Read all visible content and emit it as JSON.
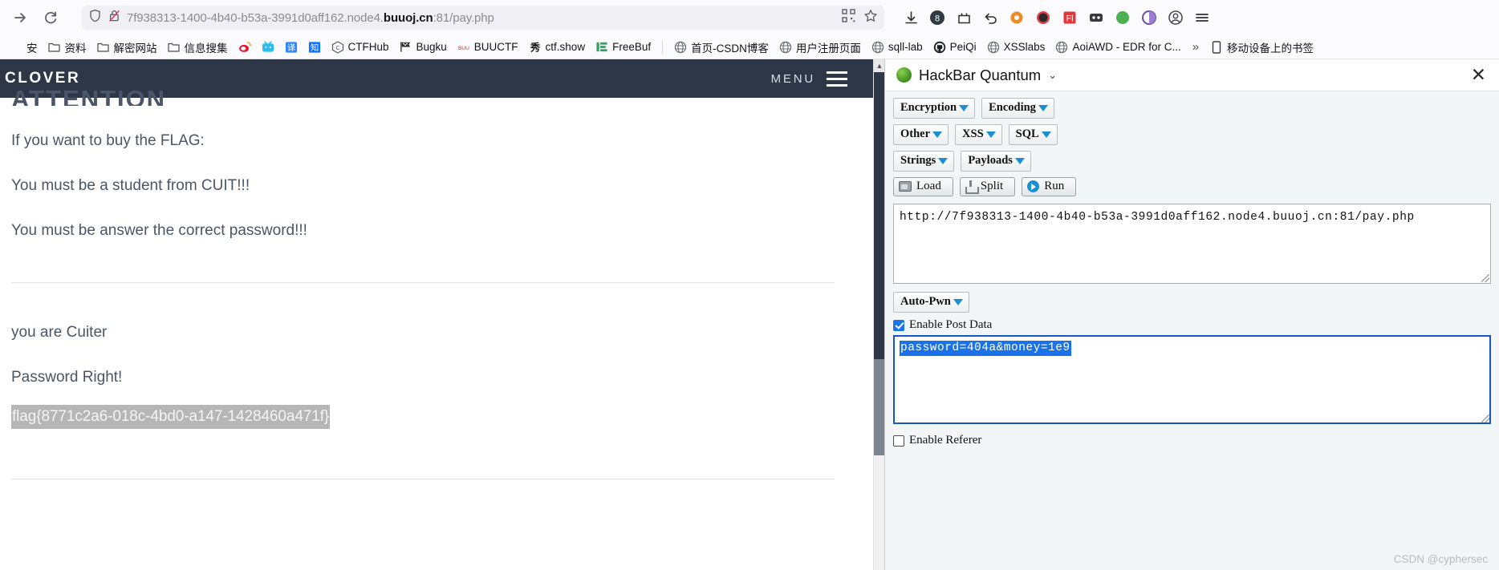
{
  "browser": {
    "nav": {
      "forward_icon": "arrow-right-icon",
      "reload_icon": "reload-icon"
    },
    "url": {
      "prefix": "7f938313-1400-4b40-b53a-3991d0aff162.node4.",
      "host": "buuoj.cn",
      "suffix": ":81/pay.php",
      "full": "7f938313-1400-4b40-b53a-3991d0aff162.node4.buuoj.cn:81/pay.php",
      "shield_icon": "shield-icon",
      "lock_broken_icon": "lock-crossed-icon",
      "qr_icon": "qr-code-icon",
      "bookmark_icon": "star-icon"
    },
    "extensions": [
      {
        "name": "downloads-icon",
        "glyph": "⬇"
      },
      {
        "name": "hackbar-badge-icon",
        "glyph": "8"
      },
      {
        "name": "screenshot-icon",
        "glyph": "⬚"
      },
      {
        "name": "undo-icon",
        "glyph": "↩"
      },
      {
        "name": "orange-gear-icon",
        "glyph": "⚙"
      },
      {
        "name": "block-icon",
        "glyph": "⛔"
      },
      {
        "name": "flash-red-icon",
        "glyph": "F"
      },
      {
        "name": "dark-square-icon",
        "glyph": "▭"
      },
      {
        "name": "green-circle-icon",
        "glyph": "●"
      },
      {
        "name": "palette-icon",
        "glyph": "◐"
      },
      {
        "name": "account-icon",
        "glyph": "○"
      },
      {
        "name": "menu-icon",
        "glyph": "☰"
      }
    ],
    "bookmarks": [
      {
        "label": "安",
        "icon": "text-icon",
        "truncated": true
      },
      {
        "label": "资料",
        "icon": "folder-icon"
      },
      {
        "label": "解密网站",
        "icon": "folder-icon"
      },
      {
        "label": "信息搜集",
        "icon": "folder-icon"
      },
      {
        "label": "",
        "icon": "weibo-icon"
      },
      {
        "label": "",
        "icon": "bilibili-icon"
      },
      {
        "label": "",
        "icon": "translate-icon"
      },
      {
        "label": "",
        "icon": "zhihu-icon"
      },
      {
        "label": "CTFHub",
        "icon": "ctfhub-icon"
      },
      {
        "label": "Bugku",
        "icon": "flag-icon"
      },
      {
        "label": "BUUCTF",
        "icon": "buuctf-icon"
      },
      {
        "label": "ctf.show",
        "icon": "ctfshow-icon"
      },
      {
        "label": "FreeBuf",
        "icon": "freebuf-icon"
      },
      {
        "label": "首页-CSDN博客",
        "icon": "globe-icon"
      },
      {
        "label": "用户注册页面",
        "icon": "globe-icon"
      },
      {
        "label": "sqll-lab",
        "icon": "globe-icon"
      },
      {
        "label": "PeiQi",
        "icon": "github-icon"
      },
      {
        "label": "XSSlabs",
        "icon": "globe-icon"
      },
      {
        "label": "AoiAWD - EDR for C...",
        "icon": "globe-icon"
      }
    ],
    "bookmarks_overflow": "»",
    "mobile_bookmarks": {
      "label": "移动设备上的书签",
      "icon": "phone-icon"
    }
  },
  "page": {
    "brand": "CLOVER",
    "menu_label": "MENU",
    "heading": "ATTENTION",
    "intro_lines": [
      "If you want to buy the FLAG:",
      "You must be a student from CUIT!!!",
      "You must be answer the correct password!!!"
    ],
    "result_lines": [
      "you are Cuiter",
      "Password Right!"
    ],
    "flag": "flag{8771c2a6-018c-4bd0-a147-1428460a471f}"
  },
  "hackbar": {
    "title": "HackBar Quantum",
    "logo_icon": "hackbar-logo-icon",
    "caret_icon": "chevron-down-icon",
    "close_icon": "close-icon",
    "menu_buttons_row1": [
      "Encryption",
      "Encoding"
    ],
    "menu_buttons_row2": [
      "Other",
      "XSS",
      "SQL"
    ],
    "menu_buttons_row3": [
      "Strings",
      "Payloads"
    ],
    "action_buttons": [
      {
        "label": "Load",
        "icon": "load-icon"
      },
      {
        "label": "Split",
        "icon": "split-icon"
      },
      {
        "label": "Run",
        "icon": "run-icon"
      }
    ],
    "url_value": "http://7f938313-1400-4b40-b53a-3991d0aff162.node4.buuoj.cn:81/pay.php",
    "autopwn_label": "Auto-Pwn",
    "enable_post_data": {
      "label": "Enable Post Data",
      "checked": true
    },
    "post_data_value": "password=404a&money=1e9",
    "enable_referer": {
      "label": "Enable Referer",
      "checked": false
    }
  },
  "watermark": "CSDN @cyphersec"
}
